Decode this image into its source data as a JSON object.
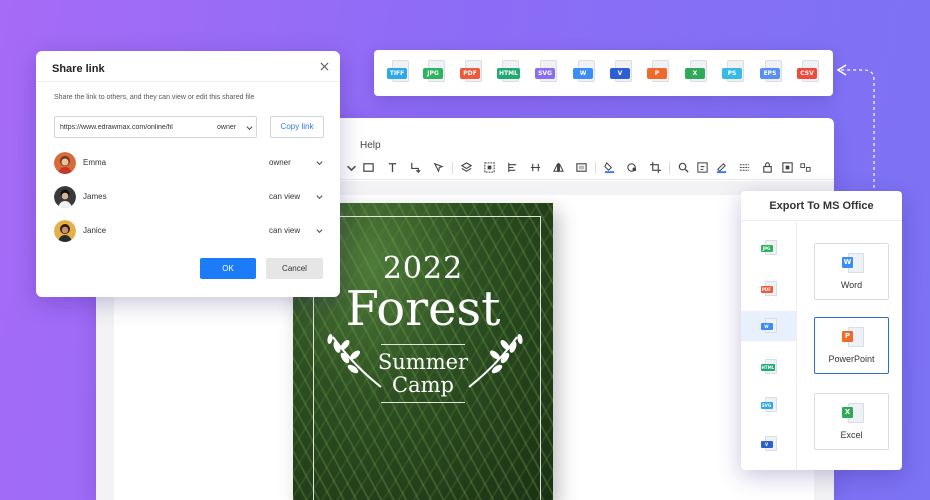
{
  "editor": {
    "menu_help": "Help"
  },
  "formats": [
    {
      "label": "TIFF",
      "color": "#2fa8e8"
    },
    {
      "label": "JPG",
      "color": "#2fb35f"
    },
    {
      "label": "PDF",
      "color": "#ef5a3b"
    },
    {
      "label": "HTML",
      "color": "#1faa72"
    },
    {
      "label": "SVG",
      "color": "#8a6ef0"
    },
    {
      "label": "W",
      "color": "#3b8cf5"
    },
    {
      "label": "V",
      "color": "#2d5fd3"
    },
    {
      "label": "P",
      "color": "#f06a2e"
    },
    {
      "label": "X",
      "color": "#2faa58"
    },
    {
      "label": "PS",
      "color": "#38b9e8"
    },
    {
      "label": "EPS",
      "color": "#5a8ff0"
    },
    {
      "label": "CSV",
      "color": "#ef4b3c"
    }
  ],
  "share": {
    "title": "Share link",
    "description": "Share the link to others, and they can view or edit this shared file",
    "url": "https://www.edrawmax.com/online/fil",
    "link_permission": "owner",
    "copy_label": "Copy link",
    "users": [
      {
        "name": "Emma",
        "permission": "owner"
      },
      {
        "name": "James",
        "permission": "can view"
      },
      {
        "name": "Janice",
        "permission": "can view"
      }
    ],
    "ok_label": "OK",
    "cancel_label": "Cancel"
  },
  "poster": {
    "year": "2022",
    "title": "Forest",
    "subtitle_line1": "Summer",
    "subtitle_line2": "Camp"
  },
  "export": {
    "title": "Export To MS Office",
    "sidebar": [
      {
        "label": "JPG",
        "color": "#2fb35f"
      },
      {
        "label": "PDF",
        "color": "#ef5a3b"
      },
      {
        "label": "W",
        "color": "#3b8cf5"
      },
      {
        "label": "HTML",
        "color": "#1faa72"
      },
      {
        "label": "SVG",
        "color": "#2fa8e8"
      },
      {
        "label": "V",
        "color": "#2d5fd3"
      }
    ],
    "options": [
      {
        "label": "Word",
        "icon": "W",
        "color": "#3b8cf5"
      },
      {
        "label": "PowerPoint",
        "icon": "P",
        "color": "#f06a2e"
      },
      {
        "label": "Excel",
        "icon": "X",
        "color": "#2faa58"
      }
    ]
  }
}
